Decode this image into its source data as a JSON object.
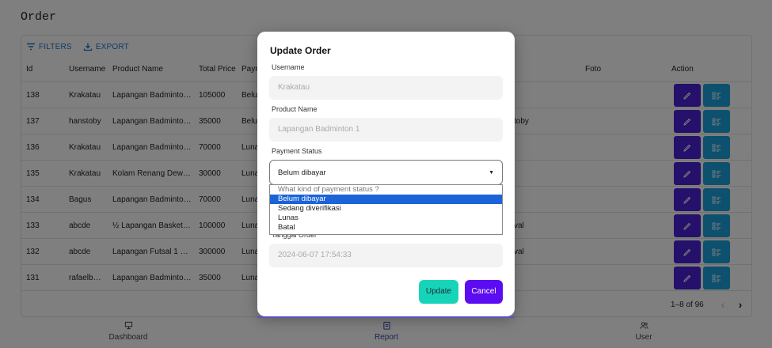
{
  "page": {
    "title": "Order"
  },
  "toolbar": {
    "filters": "FILTERS",
    "export": "EXPORT"
  },
  "table": {
    "columns": {
      "id": "Id",
      "username": "Username",
      "product": "Product Name",
      "price": "Total Price",
      "payment": "Paym",
      "foto": "Foto",
      "action": "Action"
    },
    "rows": [
      {
        "id": "138",
        "username": "Krakatau",
        "product": "Lapangan Badminton…",
        "price": "105000",
        "payment": "Belum",
        "extra": ""
      },
      {
        "id": "137",
        "username": "hanstoby",
        "product": "Lapangan Badminton…",
        "price": "35000",
        "payment": "Belur",
        "extra": "toby"
      },
      {
        "id": "136",
        "username": "Krakatau",
        "product": "Lapangan Badminton…",
        "price": "70000",
        "payment": "Luna",
        "extra": ""
      },
      {
        "id": "135",
        "username": "Krakatau",
        "product": "Kolam Renang Dewasa",
        "price": "30000",
        "payment": "Luna",
        "extra": ""
      },
      {
        "id": "134",
        "username": "Bagus",
        "product": "Lapangan Badminton…",
        "price": "70000",
        "payment": "Luna",
        "extra": ""
      },
      {
        "id": "133",
        "username": "abcde",
        "product": "½ Lapangan Basket …",
        "price": "100000",
        "payment": "Luna",
        "extra": "val"
      },
      {
        "id": "132",
        "username": "abcde",
        "product": "Lapangan Futsal 1 G…",
        "price": "300000",
        "payment": "Luna",
        "extra": "val"
      },
      {
        "id": "131",
        "username": "rafaelb…",
        "product": "Lapangan Badminton…",
        "price": "35000",
        "payment": "Luna",
        "extra": ""
      }
    ]
  },
  "pagination": {
    "range": "1–8 of 96"
  },
  "nav": {
    "dashboard": "Dashboard",
    "report": "Report",
    "user": "User"
  },
  "modal": {
    "title": "Update Order",
    "username_label": "Username",
    "username_value": "Krakatau",
    "product_label": "Product Name",
    "product_value": "Lapangan Badminton 1",
    "status_label": "Payment Status",
    "status_value": "Belum dibayar",
    "date_label": "Tanggal Order",
    "date_value": "2024-06-07 17:54:33",
    "update": "Update",
    "cancel": "Cancel"
  },
  "dropdown": {
    "options": [
      "What kind of payment status ?",
      "Belum dibayar",
      "Sedang diverifikasi",
      "Lunas",
      "Batal"
    ]
  },
  "colors": {
    "edit": "#4b20d6",
    "detail": "#1aa2dc",
    "update": "#17d4b8",
    "cancel": "#5b0cf0",
    "selected": "#1b63d8"
  }
}
